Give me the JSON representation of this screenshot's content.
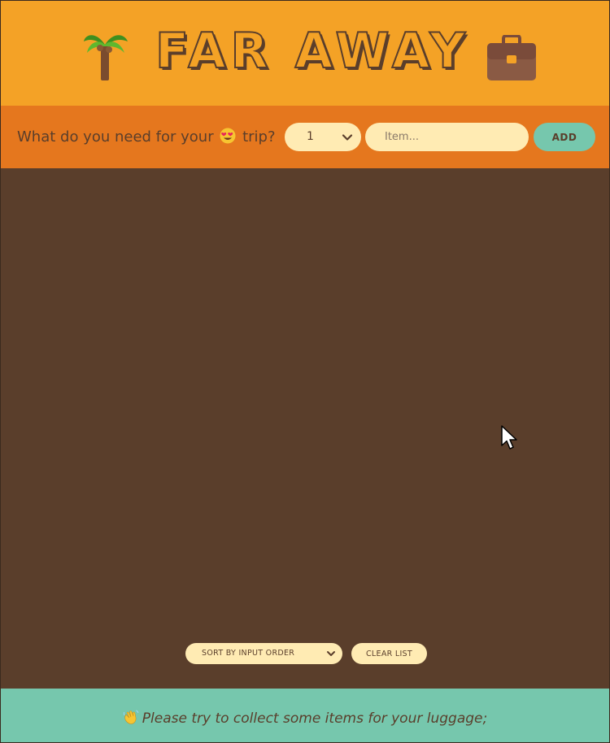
{
  "header": {
    "title": "FAR AWAY",
    "left_icon": "palm-tree-icon",
    "right_icon": "briefcase-icon"
  },
  "form": {
    "question_before": "What do you need for your",
    "question_emoji": "smiling-face-with-heart-eyes-icon",
    "question_after": "trip?",
    "quantity_value": "1",
    "item_placeholder": "Item...",
    "add_label": "ADD"
  },
  "list": {
    "sort_value": "SORT BY INPUT ORDER",
    "clear_label": "CLEAR LIST"
  },
  "footer": {
    "emoji": "waving-hand-icon",
    "text": "Please try to collect some items for your luggage;"
  },
  "colors": {
    "header_bg": "#f4a226",
    "form_bg": "#e5771e",
    "list_bg": "#5a3e2b",
    "footer_bg": "#76c7ad",
    "input_bg": "#ffebb3",
    "text_dark": "#5a3e2b"
  }
}
